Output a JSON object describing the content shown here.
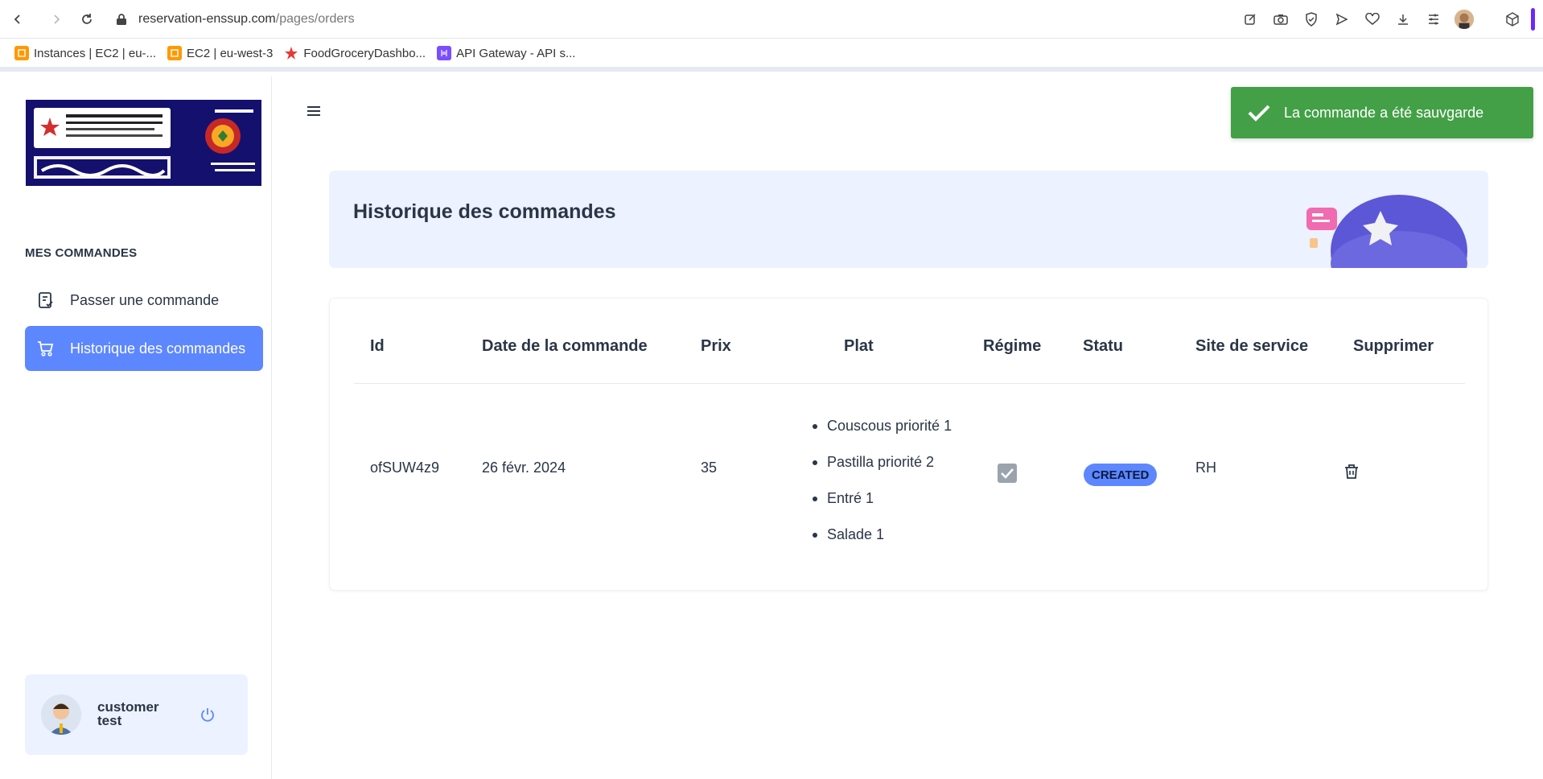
{
  "browser": {
    "url_domain": "reservation-enssup.com",
    "url_path": "/pages/orders",
    "bookmarks": [
      {
        "label": "Instances | EC2 | eu-...",
        "icon": "aws-icon",
        "color": "#ff9900"
      },
      {
        "label": "EC2 | eu-west-3",
        "icon": "aws-icon",
        "color": "#ff9900"
      },
      {
        "label": "FoodGroceryDashbo...",
        "icon": "star-logo-icon",
        "color": "#e53935"
      },
      {
        "label": "API Gateway - API s...",
        "icon": "api-gateway-icon",
        "color": "#7b4dff"
      }
    ]
  },
  "sidebar": {
    "section_title": "MES COMMANDES",
    "items": [
      {
        "label": "Passer une commande",
        "icon": "order-form-icon",
        "active": false
      },
      {
        "label": "Historique des commandes",
        "icon": "cart-icon",
        "active": true
      }
    ],
    "user": {
      "name": "customer test"
    }
  },
  "toast": {
    "message": "La commande a été sauvgarde"
  },
  "banner": {
    "title": "Historique des commandes"
  },
  "table": {
    "headers": [
      "Id",
      "Date de la commande",
      "Prix",
      "Plat",
      "Régime",
      "Statu",
      "Site de service",
      "Supprimer"
    ],
    "rows": [
      {
        "id": "ofSUW4z9",
        "date": "26 févr. 2024",
        "prix": "35",
        "plat": [
          "Couscous priorité 1",
          "Pastilla priorité 2",
          "Entré 1",
          "Salade 1"
        ],
        "regime_checked": true,
        "statut": "CREATED",
        "site": "RH"
      }
    ]
  },
  "colors": {
    "primary": "#5d87ff",
    "toast": "#43a047",
    "banner_bg": "#ecf2ff"
  }
}
